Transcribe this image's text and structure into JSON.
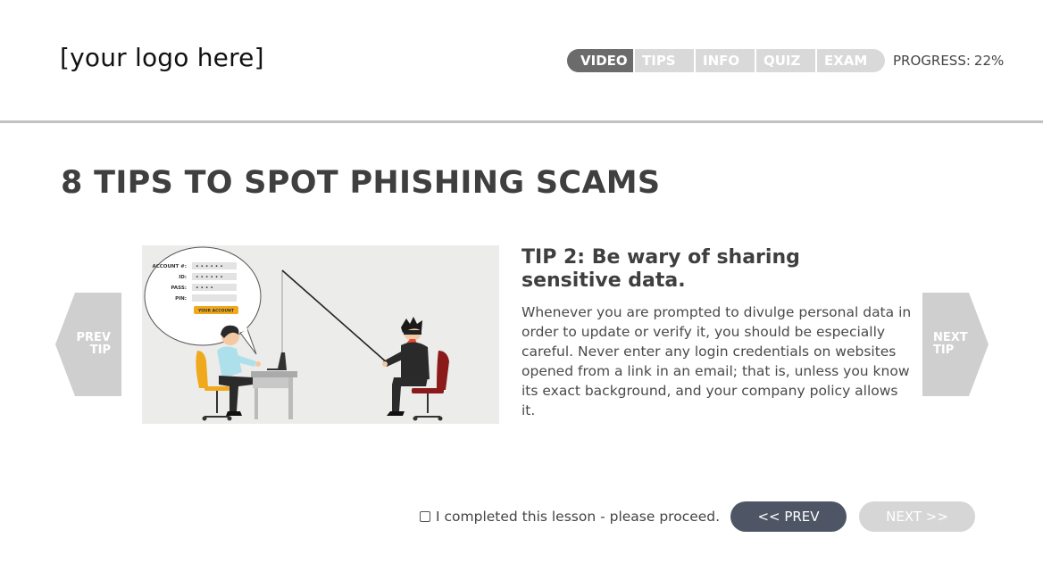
{
  "header": {
    "logo": "[your logo here]",
    "tabs": [
      {
        "label": "VIDEO",
        "active": true
      },
      {
        "label": "TIPS",
        "active": false
      },
      {
        "label": "INFO",
        "active": false
      },
      {
        "label": "QUIZ",
        "active": false
      },
      {
        "label": "EXAM",
        "active": false
      }
    ],
    "progress_label": "PROGRESS:",
    "progress_value": "22%"
  },
  "main": {
    "title": "8 TIPS TO SPOT PHISHING SCAMS",
    "prev_tip_line1": "PREV",
    "prev_tip_line2": "TIP",
    "next_tip_line1": "NEXT",
    "next_tip_line2": "TIP",
    "illustration": {
      "form_labels": [
        "ACCOUNT #:",
        "ID:",
        "PASS:",
        "PIN:"
      ],
      "button_label": "YOUR ACCOUNT"
    },
    "tip_title": "TIP 2: Be wary of sharing sensitive data.",
    "tip_body": "Whenever you are prompted to divulge personal data in order to update or verify it, you should be especially careful. Never enter any login credentials on websites opened from a link in an email; that is, unless you know its exact background, and your company policy allows it."
  },
  "footer": {
    "complete_label": "I completed this lesson - please proceed.",
    "prev_label": "<< PREV",
    "next_label": "NEXT >>"
  },
  "colors": {
    "accent_dark": "#4e5666",
    "tab_active": "#6b6b6b",
    "tab_inactive": "#d9d9d9",
    "arrow_grey": "#cfcfcf"
  }
}
